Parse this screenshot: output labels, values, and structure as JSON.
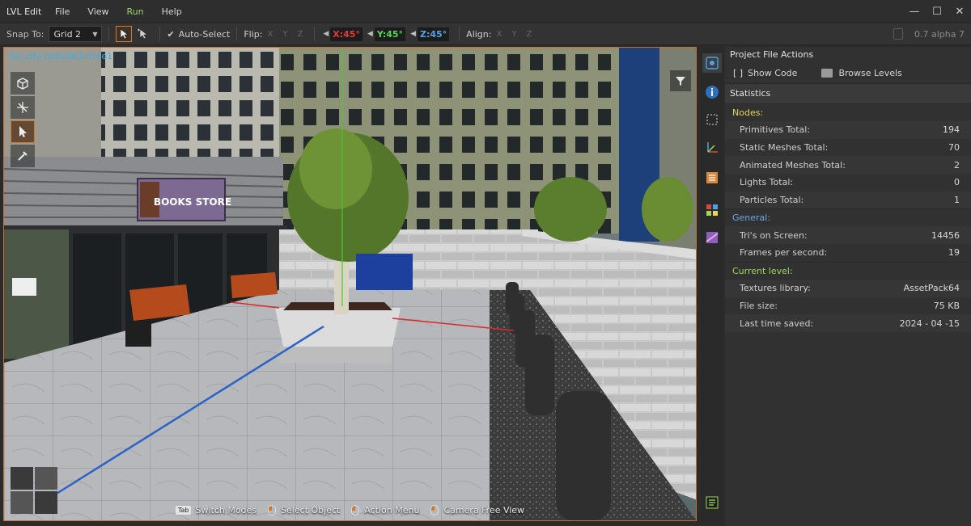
{
  "window": {
    "app_name": "LVL Edit",
    "version": "0.7 alpha 7",
    "controls": {
      "minimize": "—",
      "maximize": "☐",
      "close": "✕"
    }
  },
  "menu": [
    "File",
    "View",
    "Run",
    "Help"
  ],
  "toolbar": {
    "snap_label": "Snap To:",
    "snap_value": "Grid 2",
    "auto_select": "Auto-Select",
    "flip_label": "Flip:",
    "flip_axes": [
      "X",
      "Y",
      "Z"
    ],
    "rot_x": "X:45°",
    "rot_y": "Y:45°",
    "rot_z": "Z:45°",
    "align_label": "Align:",
    "align_axes": [
      "X",
      "Y",
      "Z"
    ]
  },
  "viewport": {
    "path": "lvl_city-outside3::tree1",
    "sign_text": "BOOKS STORE",
    "hints": [
      {
        "key": "Tab",
        "label": "Switch Modes"
      },
      {
        "label": "Select Object"
      },
      {
        "label": "Action Menu"
      },
      {
        "label": "Camera Free View"
      }
    ]
  },
  "panel": {
    "title": "Project File Actions",
    "show_code": "Show Code",
    "browse_levels": "Browse Levels",
    "statistics": "Statistics",
    "nodes_title": "Nodes:",
    "nodes": [
      {
        "label": "Primitives Total:",
        "value": "194"
      },
      {
        "label": "Static Meshes Total:",
        "value": "70"
      },
      {
        "label": "Animated Meshes Total:",
        "value": "2"
      },
      {
        "label": "Lights Total:",
        "value": "0"
      },
      {
        "label": "Particles Total:",
        "value": "1"
      }
    ],
    "general_title": "General:",
    "general": [
      {
        "label": "Tri's on Screen:",
        "value": "14456"
      },
      {
        "label": "Frames per second:",
        "value": "19"
      }
    ],
    "current_title": "Current level:",
    "current": [
      {
        "label": "Textures library:",
        "value": "AssetPack64"
      },
      {
        "label": "File size:",
        "value": "75 KB"
      },
      {
        "label": "Last time saved:",
        "value": "2024 - 04 -15"
      }
    ]
  },
  "colors": {
    "accent": "#d07a2e",
    "axis_x": "#e03b3b",
    "axis_y": "#55d45a",
    "axis_z": "#55a4e8",
    "path_text": "#3ab0e5"
  }
}
